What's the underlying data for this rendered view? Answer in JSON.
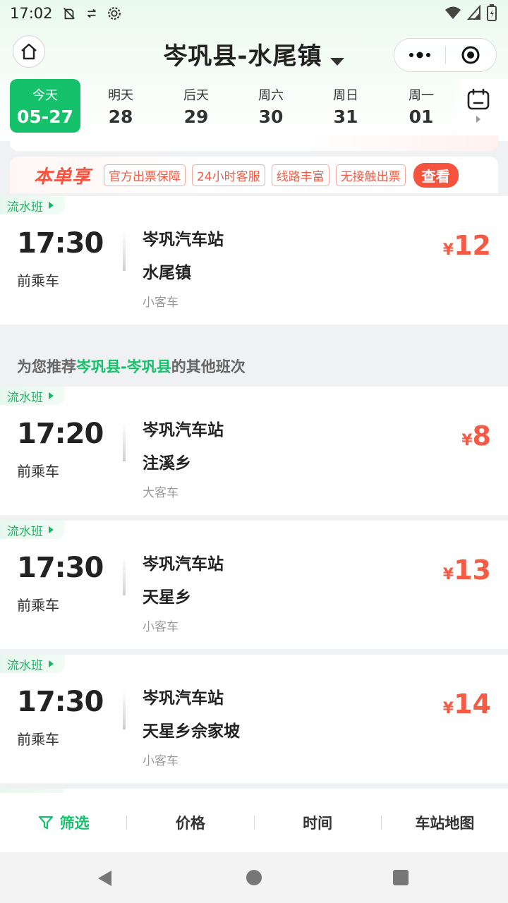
{
  "status_bar": {
    "time": "17:02"
  },
  "header": {
    "title": "岑巩县-水尾镇",
    "home_icon": "home-icon",
    "more_icon": "more-dots-icon",
    "close_icon": "target-circle-icon"
  },
  "dates": [
    {
      "weekday": "今天",
      "date": "05-27",
      "active": true
    },
    {
      "weekday": "明天",
      "date": "28"
    },
    {
      "weekday": "后天",
      "date": "29"
    },
    {
      "weekday": "周六",
      "date": "30"
    },
    {
      "weekday": "周日",
      "date": "31"
    },
    {
      "weekday": "周一",
      "date": "01"
    }
  ],
  "promo": {
    "title": "本单享",
    "tags": [
      "官方出票保障",
      "24小时客服",
      "线路丰富",
      "无接触出票"
    ],
    "button": "查看"
  },
  "schedules": [
    {
      "tag": "流水班",
      "time": "17:30",
      "note": "前乘车",
      "from": "岑巩汽车站",
      "to": "水尾镇",
      "bus": "小客车",
      "price_symbol": "¥",
      "price": "12"
    }
  ],
  "recommend": {
    "prefix": "为您推荐",
    "route": "岑巩县-岑巩县",
    "suffix": "的其他班次"
  },
  "recommended": [
    {
      "tag": "流水班",
      "time": "17:20",
      "note": "前乘车",
      "from": "岑巩汽车站",
      "to": "注溪乡",
      "bus": "大客车",
      "price_symbol": "¥",
      "price": "8"
    },
    {
      "tag": "流水班",
      "time": "17:30",
      "note": "前乘车",
      "from": "岑巩汽车站",
      "to": "天星乡",
      "bus": "小客车",
      "price_symbol": "¥",
      "price": "13"
    },
    {
      "tag": "流水班",
      "time": "17:30",
      "note": "前乘车",
      "from": "岑巩汽车站",
      "to": "天星乡佘家坡",
      "bus": "小客车",
      "price_symbol": "¥",
      "price": "14"
    }
  ],
  "filter_bar": {
    "filter": "筛选",
    "price": "价格",
    "time": "时间",
    "map": "车站地图"
  },
  "colors": {
    "accent": "#15c16a",
    "price": "#f55a45"
  }
}
